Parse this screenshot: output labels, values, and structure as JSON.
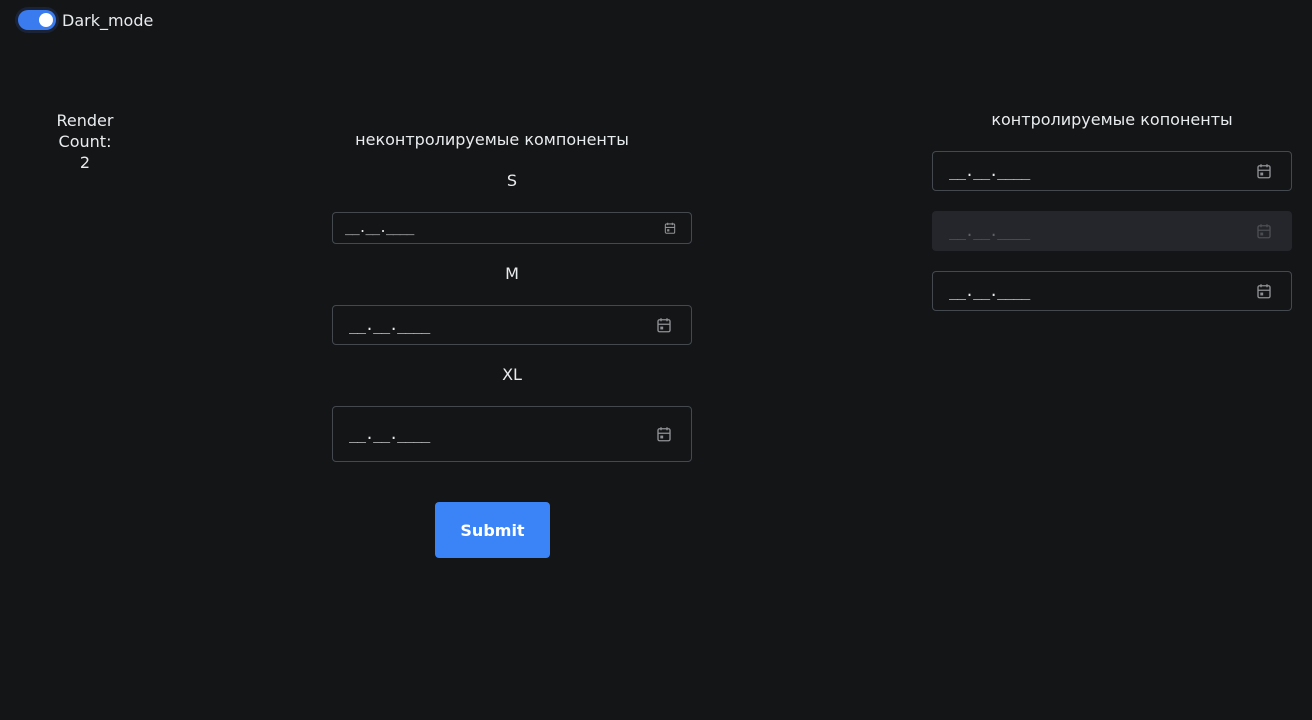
{
  "header": {
    "dark_mode_label": "Dark_mode",
    "dark_mode_on": true
  },
  "render_count": {
    "line1": "Render",
    "line2": "Count:",
    "value": "2"
  },
  "uncontrolled": {
    "title": "неконтролируемые компоненты",
    "sizes": [
      {
        "label": "S",
        "value": "__.__.____"
      },
      {
        "label": "M",
        "value": "__.__.____"
      },
      {
        "label": "XL",
        "value": "__.__.____"
      }
    ],
    "submit_label": "Submit"
  },
  "controlled": {
    "title": "контролируемые копоненты",
    "inputs": [
      {
        "value": "__.__.____",
        "disabled": false
      },
      {
        "value": "__.__.____",
        "disabled": true
      },
      {
        "value": "__.__.____",
        "disabled": false
      }
    ]
  },
  "colors": {
    "background": "#141517",
    "accent": "#3a84f7",
    "border": "#444950"
  },
  "icons": {
    "date_picker": "calendar-icon"
  }
}
